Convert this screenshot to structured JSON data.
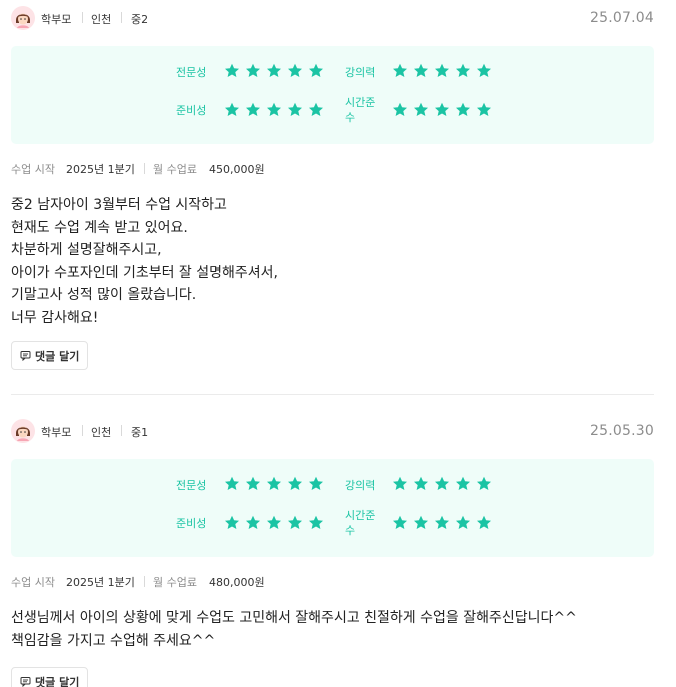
{
  "reviews": [
    {
      "author": {
        "role": "학부모",
        "region": "인천",
        "grade": "중2"
      },
      "date": "25.07.04",
      "ratings": [
        {
          "label": "전문성",
          "stars": 5
        },
        {
          "label": "강의력",
          "stars": 5
        },
        {
          "label": "준비성",
          "stars": 5
        },
        {
          "label": "시간준수",
          "stars": 5
        }
      ],
      "meta": {
        "start_label": "수업 시작",
        "start_value": "2025년 1분기",
        "fee_label": "월 수업료",
        "fee_value": "450,000원"
      },
      "content": [
        "중2 남자아이 3월부터 수업 시작하고",
        "현재도 수업 계속 받고 있어요.",
        "차분하게 설명잘해주시고,",
        "아이가 수포자인데 기초부터 잘 설명해주셔서,",
        "기말고사 성적 많이 올랐습니다.",
        "너무 감사해요!"
      ],
      "reply_label": "댓글 달기"
    },
    {
      "author": {
        "role": "학부모",
        "region": "인천",
        "grade": "중1"
      },
      "date": "25.05.30",
      "ratings": [
        {
          "label": "전문성",
          "stars": 5
        },
        {
          "label": "강의력",
          "stars": 5
        },
        {
          "label": "준비성",
          "stars": 5
        },
        {
          "label": "시간준수",
          "stars": 5
        }
      ],
      "meta": {
        "start_label": "수업 시작",
        "start_value": "2025년 1분기",
        "fee_label": "월 수업료",
        "fee_value": "480,000원"
      },
      "content": [
        "선생님께서 아이의 상황에 맞게 수업도 고민해서 잘해주시고 친절하게 수업을 잘해주신답니다^^",
        "책임감을 가지고 수업해 주세요^^"
      ],
      "reply_label": "댓글 달기"
    }
  ],
  "colors": {
    "accent": "#1bc4a4",
    "rating_bg": "#effdf9",
    "muted": "#8c8c8c"
  },
  "icons": {
    "avatar": "girl-avatar-icon",
    "star": "star-icon",
    "reply": "comment-icon"
  }
}
